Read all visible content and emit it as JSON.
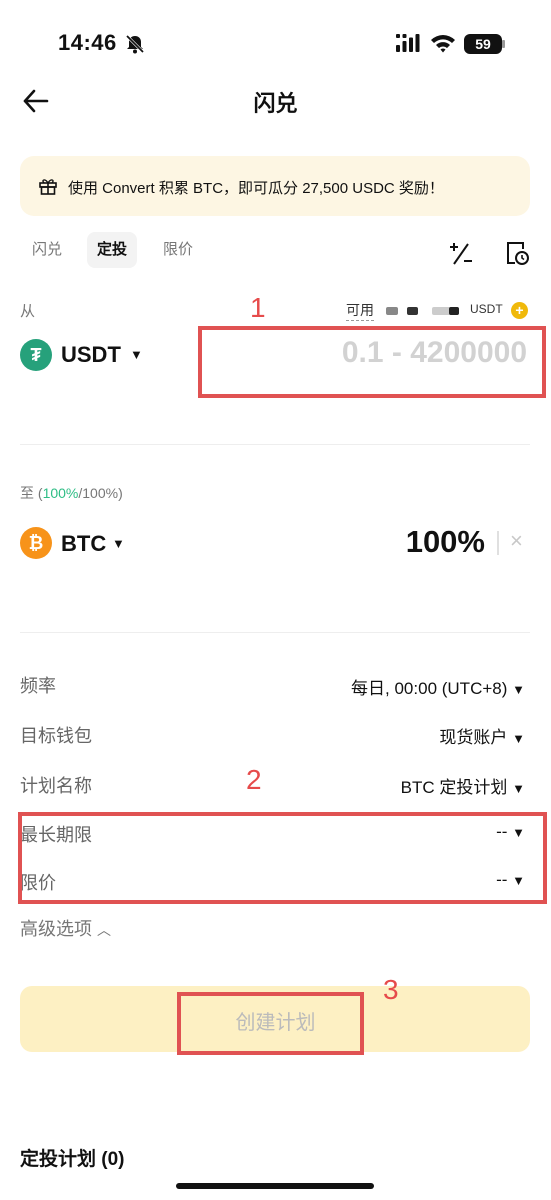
{
  "status_bar": {
    "time": "14:46",
    "battery": "59"
  },
  "header": {
    "title": "闪兑"
  },
  "banner": {
    "text": "使用 Convert 积累 BTC，即可瓜分 27,500 USDC 奖励！"
  },
  "tabs": [
    {
      "label": "闪兑"
    },
    {
      "label": "定投"
    },
    {
      "label": "限价"
    }
  ],
  "from": {
    "label": "从",
    "available_label": "可用",
    "available_unit": "USDT",
    "coin": "USDT",
    "amount_placeholder": "0.1 - 4200000"
  },
  "to": {
    "label_prefix": "至 (",
    "label_pct_green": "100%",
    "label_suffix": "/100%)",
    "coin": "BTC",
    "percent": "100%"
  },
  "settings": [
    {
      "label": "频率",
      "value": "每日, 00:00 (UTC+8)"
    },
    {
      "label": "目标钱包",
      "value": "现货账户"
    },
    {
      "label": "计划名称",
      "value": "BTC 定投计划"
    },
    {
      "label": "最长期限",
      "value": "--"
    },
    {
      "label": "限价",
      "value": "--"
    }
  ],
  "advanced": "高级选项",
  "create_button": "创建计划",
  "plans_header": "定投计划 (0)",
  "annotations": [
    "1",
    "2",
    "3"
  ],
  "colors": {
    "accent": "#f0b90b",
    "green": "#2ebd85",
    "red_box": "#e05252",
    "usdt": "#26a17b",
    "btc": "#f7931a"
  }
}
